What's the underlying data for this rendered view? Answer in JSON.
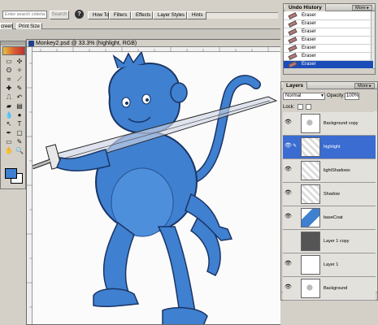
{
  "optbar": {
    "search_placeholder": "Enter search criteria",
    "search_button": "Search",
    "help_icon": "?",
    "screen_button": "creen",
    "print_size_button": "Print Size"
  },
  "tabs": [
    "How To",
    "Filters",
    "Effects",
    "Layer Styles",
    "Hints"
  ],
  "document": {
    "title": "Monkey2.psd @ 33.3% (highlight, RGB)"
  },
  "tools": {
    "icons": [
      "marquee-icon",
      "move-icon",
      "lasso-icon",
      "magic-wand-icon",
      "crop-icon",
      "slice-icon",
      "healing-icon",
      "brush-icon",
      "stamp-icon",
      "history-brush-icon",
      "eraser-icon",
      "gradient-icon",
      "blur-icon",
      "dodge-icon",
      "path-select-icon",
      "type-icon",
      "pen-icon",
      "shape-icon",
      "notes-icon",
      "eyedropper-icon",
      "hand-icon",
      "zoom-icon"
    ],
    "glyphs": [
      "▭",
      "✣",
      "ʘ",
      "✧",
      "⌗",
      "⟋",
      "✚",
      "✎",
      "⎍",
      "↶",
      "▰",
      "▤",
      "💧",
      "●",
      "↖",
      "T",
      "✒",
      "▢",
      "▭",
      "✎",
      "✋",
      "🔍"
    ],
    "foreground_color": "#3e7fcf",
    "background_color": "#ffffff"
  },
  "undo_history": {
    "title": "Undo History",
    "more": "More ▸",
    "items": [
      "Eraser",
      "Eraser",
      "Eraser",
      "Eraser",
      "Eraser",
      "Eraser",
      "Eraser"
    ],
    "selected_index": 6
  },
  "layers": {
    "title": "Layers",
    "more": "More ▸",
    "blend_mode": "Normal",
    "opacity_label": "Opacity:",
    "opacity_value": "100%",
    "lock_label": "Lock:",
    "rows": [
      {
        "name": "Background copy",
        "thumb": "sketch"
      },
      {
        "name": "highlight",
        "thumb": "transparent",
        "selected": true
      },
      {
        "name": "lightShadows",
        "thumb": "transparent"
      },
      {
        "name": "Shadow",
        "thumb": "transparent"
      },
      {
        "name": "baseCoat",
        "thumb": "blue"
      },
      {
        "name": "Layer 1 copy",
        "thumb": "gray"
      },
      {
        "name": "Layer 1",
        "thumb": "white"
      },
      {
        "name": "Background",
        "thumb": "sketch"
      }
    ]
  },
  "colors": {
    "accent": "#1b4cb8",
    "monkey_fill": "#3f80d0",
    "monkey_outline": "#1a3464"
  }
}
